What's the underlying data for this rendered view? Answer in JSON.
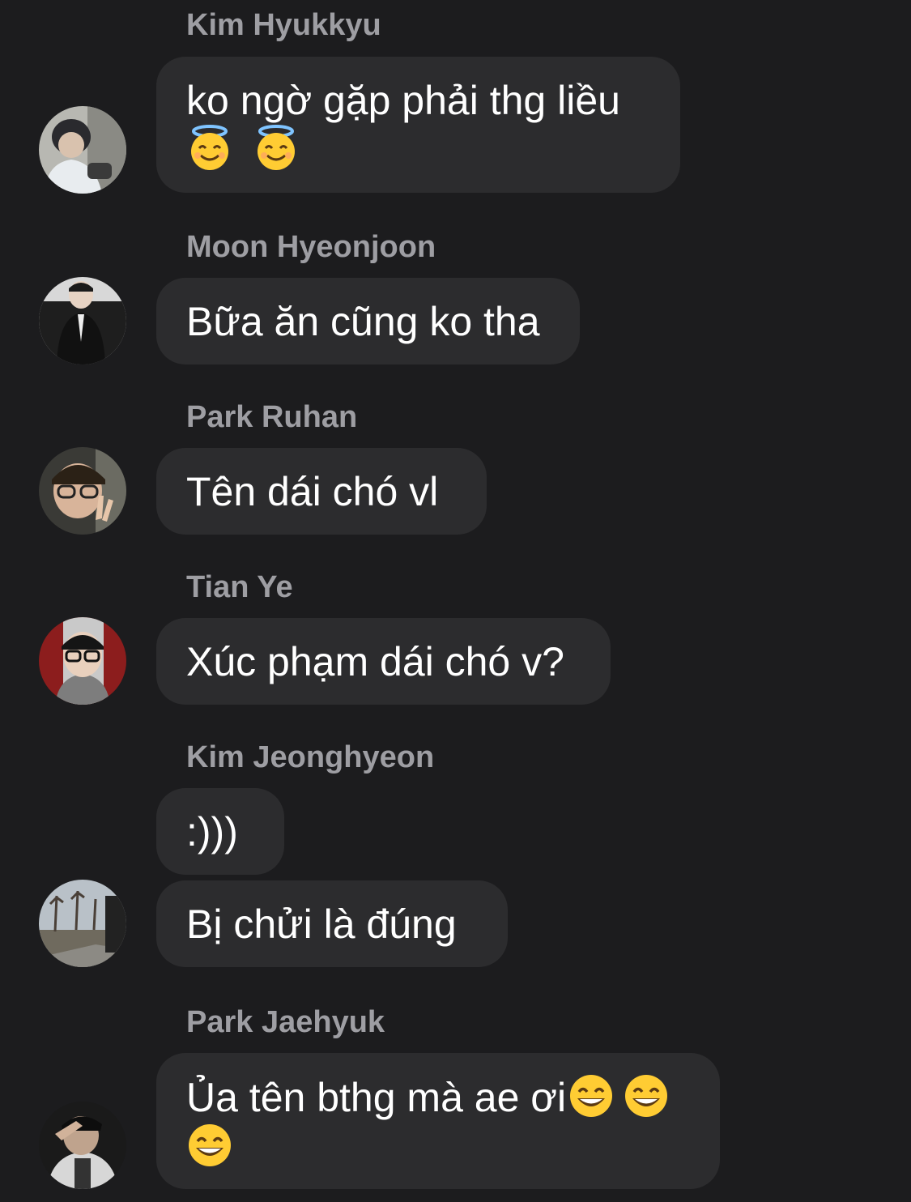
{
  "messages": [
    {
      "sender": "Kim Hyukkyu",
      "avatar_icon": "avatar-kim-hyukkyu",
      "bubbles": [
        {
          "lines": [
            "ko ngờ gặp phải thg liều"
          ],
          "emojis": [
            "smiling-face-with-halo",
            "smiling-face-with-halo"
          ]
        }
      ]
    },
    {
      "sender": "Moon Hyeonjoon",
      "avatar_icon": "avatar-moon-hyeonjoon",
      "bubbles": [
        {
          "lines": [
            "Bữa ăn cũng ko tha"
          ]
        }
      ]
    },
    {
      "sender": "Park Ruhan",
      "avatar_icon": "avatar-park-ruhan",
      "bubbles": [
        {
          "lines": [
            "Tên dái chó vl"
          ]
        }
      ]
    },
    {
      "sender": "Tian Ye",
      "avatar_icon": "avatar-tian-ye",
      "bubbles": [
        {
          "lines": [
            "Xúc phạm dái chó v?"
          ]
        }
      ]
    },
    {
      "sender": "Kim Jeonghyeon",
      "avatar_icon": "avatar-kim-jeonghyeon",
      "bubbles": [
        {
          "lines": [
            ":)))"
          ]
        },
        {
          "lines": [
            "Bị chửi là đúng"
          ]
        }
      ]
    },
    {
      "sender": "Park Jaehyuk",
      "avatar_icon": "avatar-park-jaehyuk",
      "bubbles": [
        {
          "lines": [
            "Ủa tên bthg mà ae ơi"
          ],
          "emojis": [
            "beaming-face-with-smiling-eyes",
            "beaming-face-with-smiling-eyes",
            "beaming-face-with-smiling-eyes"
          ]
        }
      ]
    }
  ],
  "colors": {
    "background": "#1c1c1e",
    "bubble": "#2c2c2e",
    "sender_name": "#9e9ea3",
    "message_text": "#ffffff"
  }
}
